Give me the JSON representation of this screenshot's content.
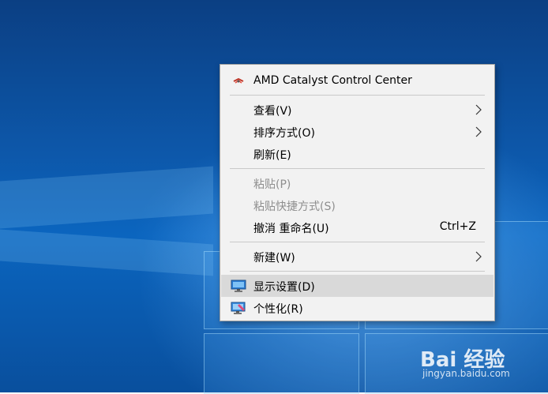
{
  "context_menu": {
    "items": [
      {
        "label": "AMD Catalyst Control Center",
        "icon": "amd-catalyst-icon"
      },
      {
        "label": "查看(V)",
        "submenu": true
      },
      {
        "label": "排序方式(O)",
        "submenu": true
      },
      {
        "label": "刷新(E)"
      },
      {
        "label": "粘贴(P)",
        "disabled": true
      },
      {
        "label": "粘贴快捷方式(S)",
        "disabled": true
      },
      {
        "label": "撤消 重命名(U)",
        "shortcut": "Ctrl+Z"
      },
      {
        "label": "新建(W)",
        "submenu": true
      },
      {
        "label": "显示设置(D)",
        "icon": "display-settings-icon",
        "highlighted": true
      },
      {
        "label": "个性化(R)",
        "icon": "personalize-icon"
      }
    ]
  },
  "watermark": {
    "brand": "Bai 经验",
    "url": "jingyan.baidu.com"
  },
  "colors": {
    "menu_bg": "#f2f2f2",
    "highlight": "#d9d9d9",
    "disabled_text": "#8e8e8e",
    "desktop_blue": "#0d57a9"
  }
}
